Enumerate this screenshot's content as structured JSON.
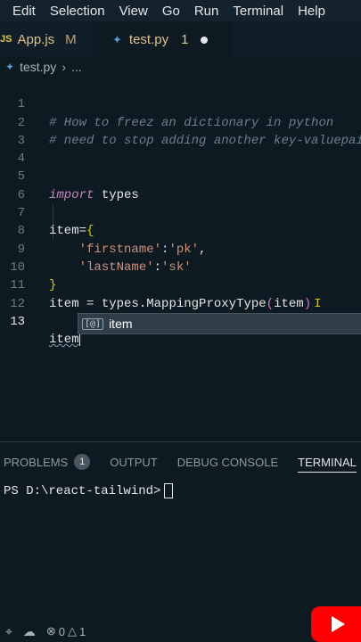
{
  "menubar": {
    "items": [
      "Edit",
      "Selection",
      "View",
      "Go",
      "Run",
      "Terminal",
      "Help"
    ]
  },
  "tabs": [
    {
      "icon": "JS",
      "name": "App.js",
      "status": "M"
    },
    {
      "name": "test.py",
      "problems": "1"
    }
  ],
  "breadcrumb": {
    "file": "test.py",
    "rest": "..."
  },
  "editor": {
    "line_numbers": [
      "1",
      "2",
      "3",
      "4",
      "5",
      "6",
      "7",
      "8",
      "9",
      "10",
      "11",
      "12",
      "13"
    ],
    "line1": "# How to freez an dictionary in python",
    "line2": "# need to stop adding another key-valuepair",
    "line5_kw": "import",
    "line5_mod": " types",
    "line7_var": "item",
    "line7_eq": "=",
    "line7_brace": "{",
    "line8_indent": "    ",
    "line8_key": "'firstname'",
    "line8_colon": ":",
    "line8_val": "'pk'",
    "line8_comma": ",",
    "line9_indent": "    ",
    "line9_key": "'lastName'",
    "line9_colon": ":",
    "line9_val": "'sk'",
    "line10_brace": "}",
    "line11_var": "item",
    "line11_eq": " = ",
    "line11_mod": "types",
    "line11_dot": ".",
    "line11_fn": "MappingProxyType",
    "line11_open": "(",
    "line11_arg": "item",
    "line11_close": ")",
    "line13_text": "item"
  },
  "suggest": {
    "icon": "[@]",
    "label": "item"
  },
  "panel": {
    "tabs": [
      "PROBLEMS",
      "OUTPUT",
      "DEBUG CONSOLE",
      "TERMINAL"
    ],
    "problems_count": "1",
    "terminal_prompt": "PS D:\\react-tailwind>"
  },
  "statusbar": {
    "errors": "0",
    "warnings": "1"
  },
  "colors": {
    "accent": "#ff0000",
    "background": "#0d1a22"
  }
}
